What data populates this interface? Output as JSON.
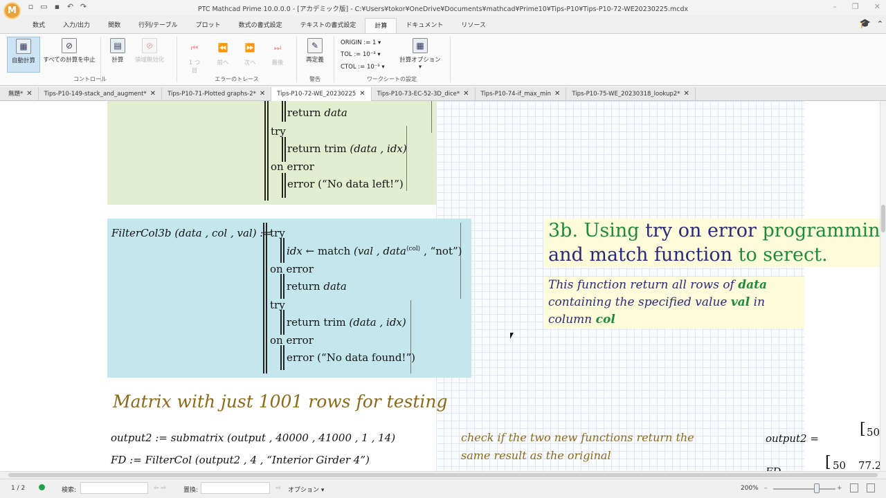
{
  "app": {
    "logo": "M",
    "title": "PTC Mathcad Prime 10.0.0.0 - [アカデミック版] - C:¥Users¥tokor¥OneDrive¥Documents¥mathcad¥Prime10¥Tips-P10¥Tips-P10-72-WE20230225.mcdx"
  },
  "ribbon_tabs": [
    "数式",
    "入力/出力",
    "関数",
    "行列/テーブル",
    "プロット",
    "数式の書式設定",
    "テキストの書式設定",
    "計算",
    "ドキュメント",
    "リソース"
  ],
  "ribbon": {
    "auto_calc": "自動計算",
    "stop_all": "すべての計算を中止",
    "calc": "計算",
    "disable_region": "領域無効化",
    "group_control": "コントロール",
    "step_one": "1 つ",
    "step_one_sub": "目",
    "back": "前へ",
    "next": "次へ",
    "last": "最後",
    "group_trace": "エラーのトレース",
    "redefine": "再定義",
    "group_warn": "警告",
    "origin": "ORIGIN := 1",
    "tol": "TOL := 10⁻³",
    "ctol": "CTOL := 10⁻³",
    "calc_options": "計算オプション",
    "group_worksheet": "ワークシートの設定"
  },
  "doc_tabs": [
    {
      "label": "無題*",
      "active": false
    },
    {
      "label": "Tips-P10-149-stack_and_augment*",
      "active": false
    },
    {
      "label": "Tips-P10-71-Plotted graphs-2*",
      "active": false
    },
    {
      "label": "Tips-P10-72-WE_20230225",
      "active": true
    },
    {
      "label": "Tips-P10-73-EC-52-3D_dice*",
      "active": false
    },
    {
      "label": "Tips-P10-74-if_max_min",
      "active": false
    },
    {
      "label": "Tips-P10-75-WE_20230318_lookup2*",
      "active": false
    }
  ],
  "region1": {
    "line1": "return",
    "line1b": "data",
    "line2": "try",
    "line3": "return  trim",
    "line3b": "(data , idx)",
    "line4": "on error",
    "line5": "error (“No data left!”)"
  },
  "region2": {
    "def": "FilterCol3b",
    "args": "(data , col , val) :=",
    "l1": "try",
    "l2a": "idx",
    "l2b": "← match",
    "l2c": "(val , data",
    "l2d": "⟨col⟩",
    "l2e": ", “not”)",
    "l3": "on error",
    "l4a": "return",
    "l4b": "data",
    "l5": "try",
    "l6a": "return  trim",
    "l6b": "(data , idx)",
    "l7": "on error",
    "l8": "error (“No data found!”)"
  },
  "heading": {
    "p1": "3b. Using ",
    "p2": "try on error",
    "p3": " programming",
    "p4": "and match function",
    "p5": " to serect."
  },
  "desc": {
    "d1": "This function return all rows of ",
    "d2": "data",
    "d3": "containing the specified value ",
    "d4": "val",
    "d5": " in",
    "d6": "column ",
    "d7": "col"
  },
  "title2": "Matrix with just 1001 rows for testing",
  "eq1": {
    "lhs": "output2",
    "rest": ":= submatrix (output , 40000 , 41000 , 1 , 14)"
  },
  "eq2": {
    "lhs": "FD",
    "rest": ":= FilterCol (output2 , 4 , “Interior Girder 4”)"
  },
  "comment": {
    "l1": "check if the two new functions return the",
    "l2": "same result as the original"
  },
  "eval": {
    "lhs": "output2 =",
    "v1": "50",
    "lhs2": "FD",
    "v2": "50",
    "v3": "77.2"
  },
  "status": {
    "page": "1 / 2",
    "search": "検索:",
    "replace": "置換:",
    "options": "オプション",
    "zoom": "200%"
  },
  "colors": {
    "green_region": "#e3edcf",
    "cyan_region": "#c3e7ec",
    "heading_green": "#1f8a3b",
    "heading_dark": "#2b2a78",
    "note_bg": "#fdfbd9"
  }
}
